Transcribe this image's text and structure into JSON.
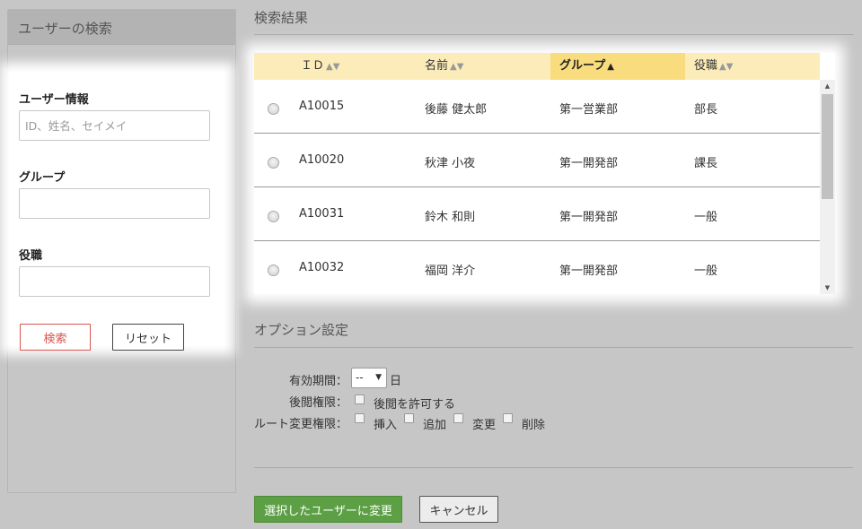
{
  "search_panel": {
    "title": "ユーザーの検索",
    "user_info_label": "ユーザー情報",
    "user_info_placeholder": "ID、姓名、セイメイ",
    "user_info_value": "",
    "group_label": "グループ",
    "group_value": "",
    "position_label": "役職",
    "position_value": "",
    "search_button": "検索",
    "reset_button": "リセット"
  },
  "results": {
    "title": "検索結果",
    "columns": [
      {
        "label": "ＩＤ",
        "sort_icon": "sort-both-icon",
        "active": false
      },
      {
        "label": "名前",
        "sort_icon": "sort-both-icon",
        "active": false
      },
      {
        "label": "グループ",
        "sort_icon": "sort-asc-icon",
        "active": true
      },
      {
        "label": "役職",
        "sort_icon": "sort-both-icon",
        "active": false
      }
    ],
    "rows": [
      {
        "id": "A10015",
        "name": "後藤 健太郎",
        "group": "第一営業部",
        "position": "部長"
      },
      {
        "id": "A10020",
        "name": "秋津 小夜",
        "group": "第一開発部",
        "position": "課長"
      },
      {
        "id": "A10031",
        "name": "鈴木 和則",
        "group": "第一開発部",
        "position": "一般"
      },
      {
        "id": "A10032",
        "name": "福岡 洋介",
        "group": "第一開発部",
        "position": "一般"
      }
    ]
  },
  "options": {
    "title": "オプション設定",
    "period_label": "有効期間：",
    "period_value": "--",
    "period_unit": "日",
    "later_label": "後閲権限：",
    "later_checkbox": "後閲を許可する",
    "route_label": "ルート変更権限：",
    "route_insert": "挿入",
    "route_add": "追加",
    "route_change": "変更",
    "route_delete": "削除"
  },
  "actions": {
    "apply_button": "選択したユーザーに変更",
    "cancel_button": "キャンセル"
  },
  "colors": {
    "header_bg": "#fcecb9",
    "active_header_bg": "#f8dc7d",
    "apply_green": "#5c9f45",
    "search_red": "#d9534f"
  }
}
